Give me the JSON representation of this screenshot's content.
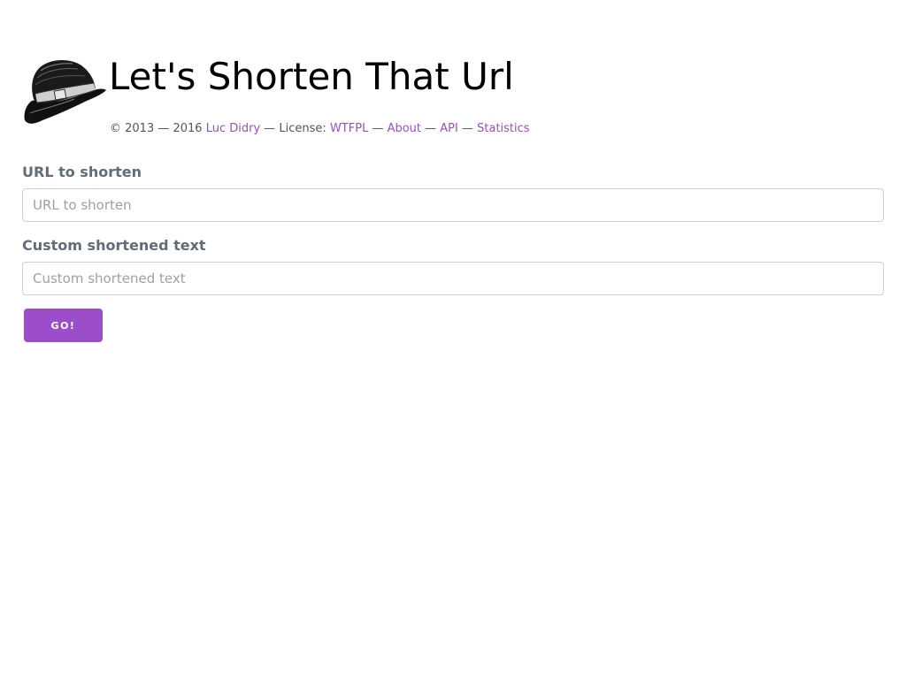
{
  "header": {
    "title": "Let's Shorten That Url",
    "logo_icon": "bowler-hat-icon"
  },
  "footer": {
    "copyright": "© 2013 — 2016 ",
    "author": "Luc Didry",
    "sep1": " — License: ",
    "license": "WTFPL",
    "sep2": " — ",
    "about": "About",
    "sep3": " — ",
    "api": "API",
    "sep4": " — ",
    "statistics": "Statistics"
  },
  "form": {
    "url_label": "URL to shorten",
    "url_placeholder": "URL to shorten",
    "url_value": "",
    "custom_label": "Custom shortened text",
    "custom_placeholder": "Custom shortened text",
    "custom_value": "",
    "submit_label": "GO!"
  },
  "colors": {
    "accent": "#9b4dca",
    "label": "#606c76",
    "border": "#d1d1d1"
  }
}
